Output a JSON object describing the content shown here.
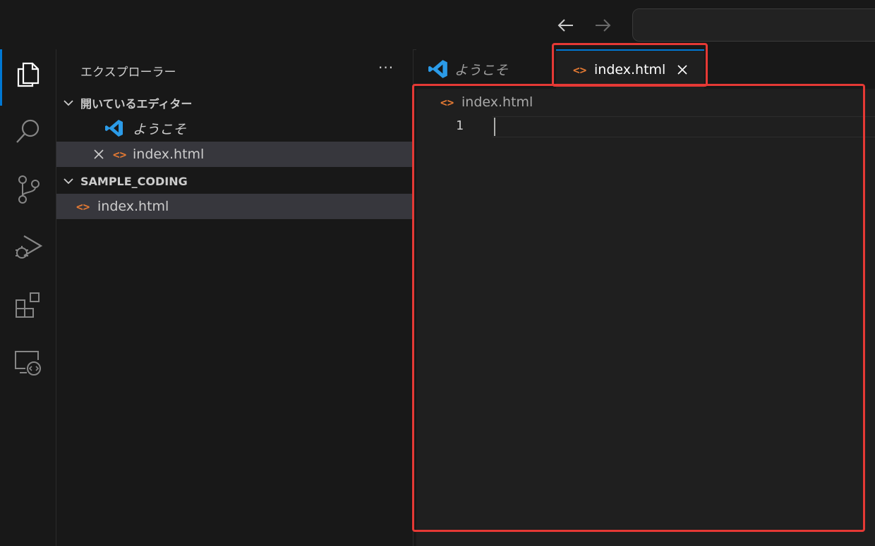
{
  "sidebar": {
    "title": "エクスプローラー",
    "more_label": "···",
    "open_editors": {
      "header": "開いているエディター",
      "items": [
        {
          "label": "ようこそ",
          "icon": "vscode-logo-icon"
        },
        {
          "label": "index.html",
          "icon": "html-file-icon"
        }
      ]
    },
    "workspace": {
      "header": "SAMPLE_CODING",
      "items": [
        {
          "label": "index.html",
          "icon": "html-file-icon"
        }
      ]
    }
  },
  "editor": {
    "tabs": [
      {
        "label": "ようこそ",
        "active": false
      },
      {
        "label": "index.html",
        "active": true
      }
    ],
    "breadcrumb": "index.html",
    "line_numbers": [
      "1"
    ]
  },
  "colors": {
    "accent": "#0078d4",
    "html_icon": "#e37933",
    "vscode_blue": "#2b9be8",
    "highlight": "#e53935"
  }
}
